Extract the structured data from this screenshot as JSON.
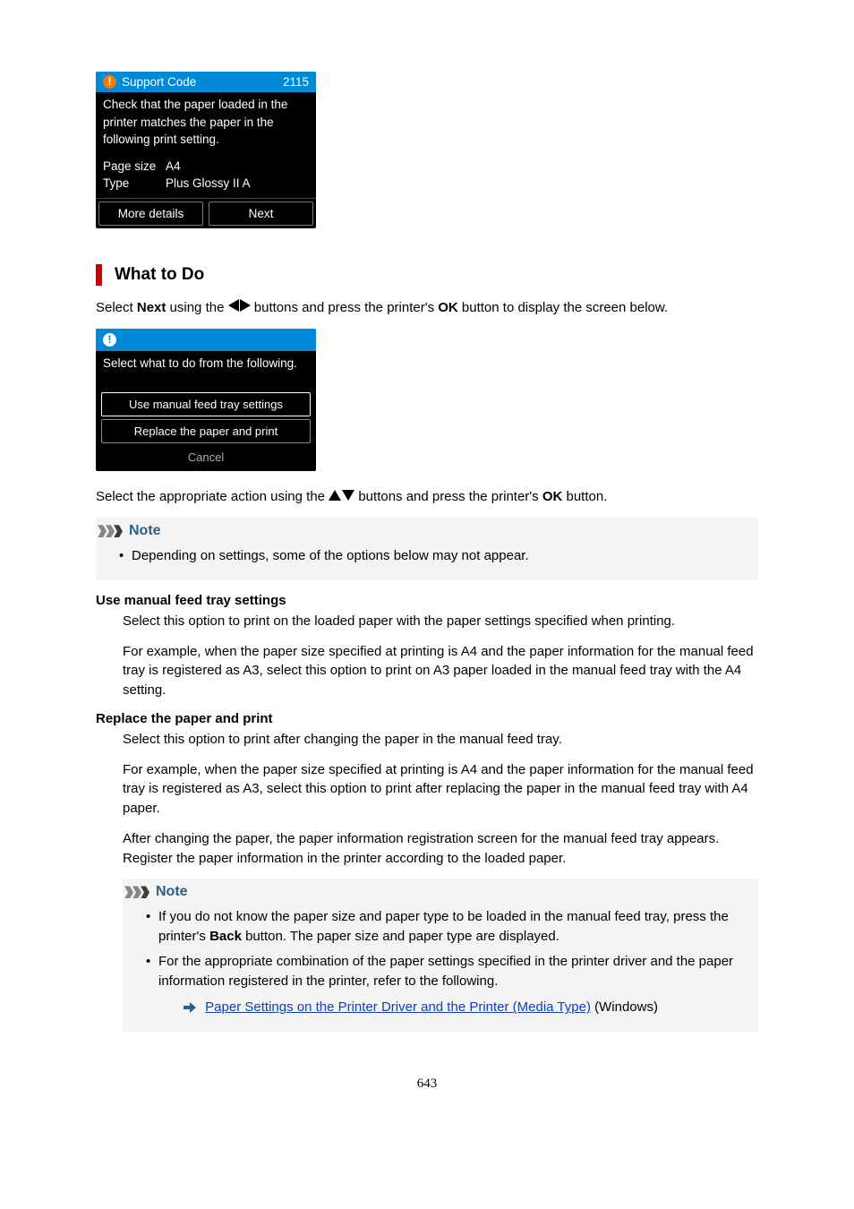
{
  "lcd1": {
    "header_label": "Support Code",
    "code": "2115",
    "message": "Check that the paper loaded in the printer matches the paper in the following print setting.",
    "page_size_label": "Page size",
    "page_size_value": "A4",
    "type_label": "Type",
    "type_value": "Plus Glossy II A",
    "btn_more": "More details",
    "btn_next": "Next"
  },
  "section_title": "What to Do",
  "instr1_a": "Select ",
  "instr1_b": "Next",
  "instr1_c": " using the ",
  "instr1_d": " buttons and press the printer's ",
  "instr1_e": "OK",
  "instr1_f": " button to display the screen below.",
  "lcd2": {
    "message": "Select what to do from the following.",
    "opt1": "Use manual feed tray settings",
    "opt2": "Replace the paper and print",
    "opt3": "Cancel"
  },
  "instr2_a": "Select the appropriate action using the ",
  "instr2_b": " buttons and press the printer's ",
  "instr2_c": "OK",
  "instr2_d": " button.",
  "note_label": "Note",
  "note1_item": "Depending on settings, some of the options below may not appear.",
  "defs": {
    "t1": "Use manual feed tray settings",
    "t1p1": "Select this option to print on the loaded paper with the paper settings specified when printing.",
    "t1p2": "For example, when the paper size specified at printing is A4 and the paper information for the manual feed tray is registered as A3, select this option to print on A3 paper loaded in the manual feed tray with the A4 setting.",
    "t2": "Replace the paper and print",
    "t2p1": "Select this option to print after changing the paper in the manual feed tray.",
    "t2p2": "For example, when the paper size specified at printing is A4 and the paper information for the manual feed tray is registered as A3, select this option to print after replacing the paper in the manual feed tray with A4 paper.",
    "t2p3": "After changing the paper, the paper information registration screen for the manual feed tray appears. Register the paper information in the printer according to the loaded paper."
  },
  "note2": {
    "i1a": "If you do not know the paper size and paper type to be loaded in the manual feed tray, press the printer's ",
    "i1b": "Back",
    "i1c": " button. The paper size and paper type are displayed.",
    "i2": "For the appropriate combination of the paper settings specified in the printer driver and the paper information registered in the printer, refer to the following.",
    "link_text": "Paper Settings on the Printer Driver and the Printer (Media Type)",
    "link_suffix": " (Windows)"
  },
  "page_number": "643"
}
